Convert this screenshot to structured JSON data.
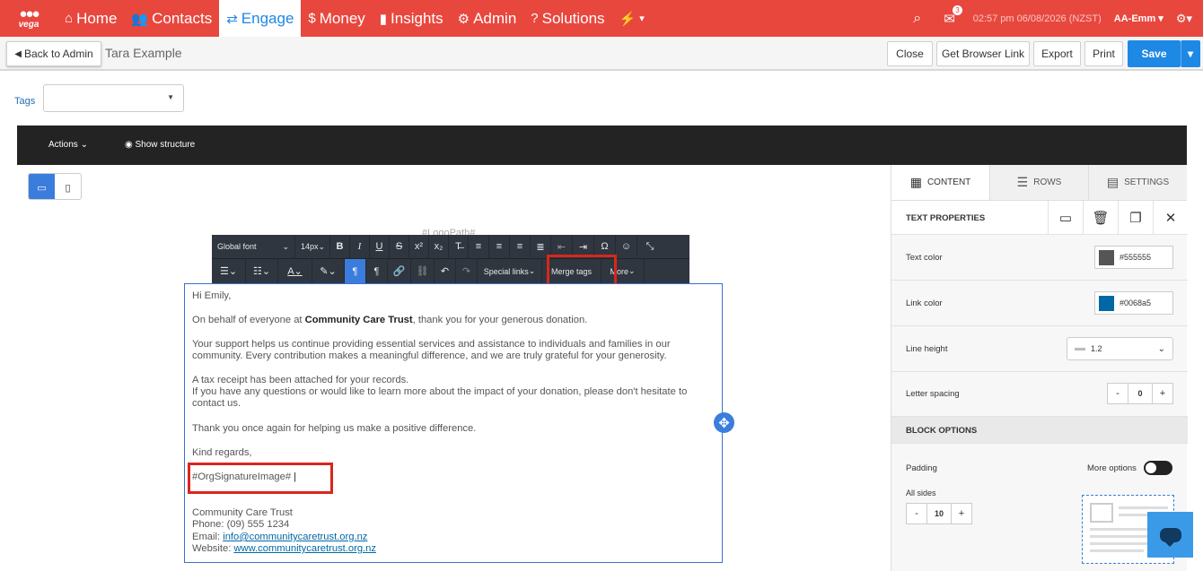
{
  "nav": {
    "logo_text": "vega",
    "items": [
      {
        "icon": "⌂",
        "label": "Home"
      },
      {
        "icon": "👥",
        "label": "Contacts"
      },
      {
        "icon": "⇄",
        "label": "Engage"
      },
      {
        "icon": "$",
        "label": "Money"
      },
      {
        "icon": "▮",
        "label": "Insights"
      },
      {
        "icon": "⚙",
        "label": "Admin"
      },
      {
        "icon": "?",
        "label": "Solutions"
      },
      {
        "icon": "⚡",
        "label": "▾"
      }
    ],
    "notification_count": "3",
    "datetime": "02:57 pm 06/08/2026 (NZST)",
    "user": "AA-Emm ▾",
    "settings": "⚙▾"
  },
  "subbar": {
    "back_label": "Back to Admin",
    "page_name": "Tara Example",
    "close_label": "Close",
    "browser_link_label": "Get Browser Link",
    "export_label": "Export",
    "print_label": "Print",
    "save_label": "Save"
  },
  "tags": {
    "label": "Tags"
  },
  "editor": {
    "actions_label": "Actions",
    "structure_label": "Show structure",
    "logo_path": "#LogoPath#"
  },
  "toolbar": {
    "font": "Global font",
    "size": "14px",
    "special_links": "Special links",
    "merge_tags": "Merge tags",
    "more": "More"
  },
  "email": {
    "greeting": "Hi Emily,",
    "p1_before": "On behalf of everyone at ",
    "p1_org": "Community Care Trust",
    "p1_after": ", thank you for your generous donation.",
    "p2": "Your support helps us continue providing essential services and assistance to individuals and families in our community. Every contribution makes a meaningful difference, and we are truly grateful for your generosity.",
    "p3": "A tax receipt has been attached for your records.",
    "p4": "If you have any questions or would like to learn more about the impact of your donation, please don't hesitate to contact us.",
    "p5": "Thank you once again for helping us make a positive difference.",
    "closing": "Kind regards,",
    "signature_tag": "#OrgSignatureImage#",
    "org_name": "Community Care Trust",
    "phone_line": "Phone: (09) 555 1234",
    "email_label": "Email: ",
    "email_value": "info@communitycaretrust.org.nz",
    "website_label": "Website: ",
    "website_value": "www.communitycaretrust.org.nz"
  },
  "panel": {
    "tabs": [
      "CONTENT",
      "ROWS",
      "SETTINGS"
    ],
    "text_properties": "TEXT PROPERTIES",
    "text_color_label": "Text color",
    "text_color": "#555555",
    "link_color_label": "Link color",
    "link_color": "#0068a5",
    "line_height_label": "Line height",
    "line_height": "1.2",
    "letter_spacing_label": "Letter spacing",
    "letter_spacing": "0",
    "block_options": "BLOCK OPTIONS",
    "padding_label": "Padding",
    "more_options_label": "More options",
    "all_sides_label": "All sides",
    "padding_value": "10"
  }
}
